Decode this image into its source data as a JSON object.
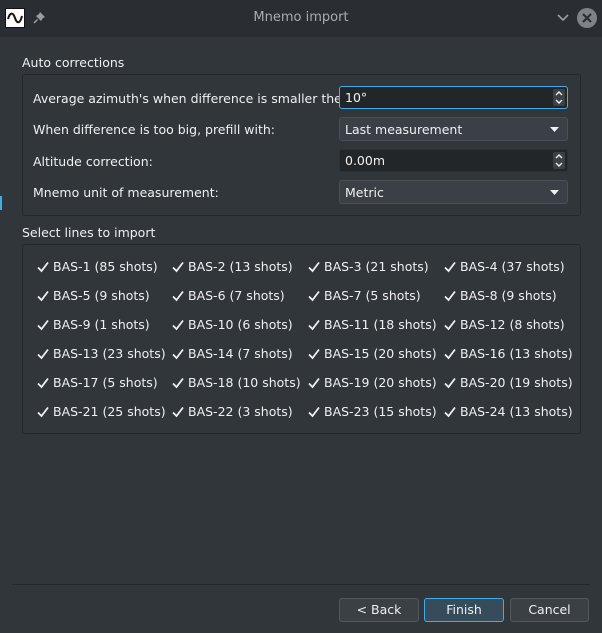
{
  "window": {
    "title": "Mnemo import"
  },
  "auto_corrections": {
    "title": "Auto corrections",
    "rows": [
      {
        "label": "Average azimuth's when difference is smaller then:",
        "value": "10°",
        "kind": "spinbox"
      },
      {
        "label": "When difference is too big, prefill with:",
        "value": "Last measurement",
        "kind": "combo"
      },
      {
        "label": "Altitude correction:",
        "value": "0.00m",
        "kind": "spinbox"
      },
      {
        "label": "Mnemo unit of measurement:",
        "value": "Metric",
        "kind": "combo"
      }
    ]
  },
  "lines": {
    "title": "Select lines to import",
    "items": [
      {
        "label": "BAS-1 (85 shots)",
        "checked": true
      },
      {
        "label": "BAS-2 (13 shots)",
        "checked": true
      },
      {
        "label": "BAS-3 (21 shots)",
        "checked": true
      },
      {
        "label": "BAS-4 (37 shots)",
        "checked": true
      },
      {
        "label": "BAS-5 (9 shots)",
        "checked": true
      },
      {
        "label": "BAS-6 (7 shots)",
        "checked": true
      },
      {
        "label": "BAS-7 (5 shots)",
        "checked": true
      },
      {
        "label": "BAS-8 (9 shots)",
        "checked": true
      },
      {
        "label": "BAS-9 (1 shots)",
        "checked": true
      },
      {
        "label": "BAS-10 (6 shots)",
        "checked": true
      },
      {
        "label": "BAS-11 (18 shots)",
        "checked": true
      },
      {
        "label": "BAS-12 (8 shots)",
        "checked": true
      },
      {
        "label": "BAS-13 (23 shots)",
        "checked": true
      },
      {
        "label": "BAS-14 (7 shots)",
        "checked": true
      },
      {
        "label": "BAS-15 (20 shots)",
        "checked": true
      },
      {
        "label": "BAS-16 (13 shots)",
        "checked": true
      },
      {
        "label": "BAS-17 (5 shots)",
        "checked": true
      },
      {
        "label": "BAS-18 (10 shots)",
        "checked": true
      },
      {
        "label": "BAS-19 (20 shots)",
        "checked": true
      },
      {
        "label": "BAS-20 (19 shots)",
        "checked": true
      },
      {
        "label": "BAS-21 (25 shots)",
        "checked": true
      },
      {
        "label": "BAS-22 (3 shots)",
        "checked": true
      },
      {
        "label": "BAS-23 (15 shots)",
        "checked": true
      },
      {
        "label": "BAS-24 (13 shots)",
        "checked": true
      }
    ]
  },
  "buttons": {
    "back": "< Back",
    "finish": "Finish",
    "cancel": "Cancel"
  },
  "colors": {
    "accent": "#3daee9",
    "background": "#31363b",
    "text": "#eff0f1"
  },
  "icons": {
    "app": "mnemo-wave-icon",
    "pin": "pin-icon",
    "minimize": "chevron-down-icon",
    "close": "close-icon"
  }
}
